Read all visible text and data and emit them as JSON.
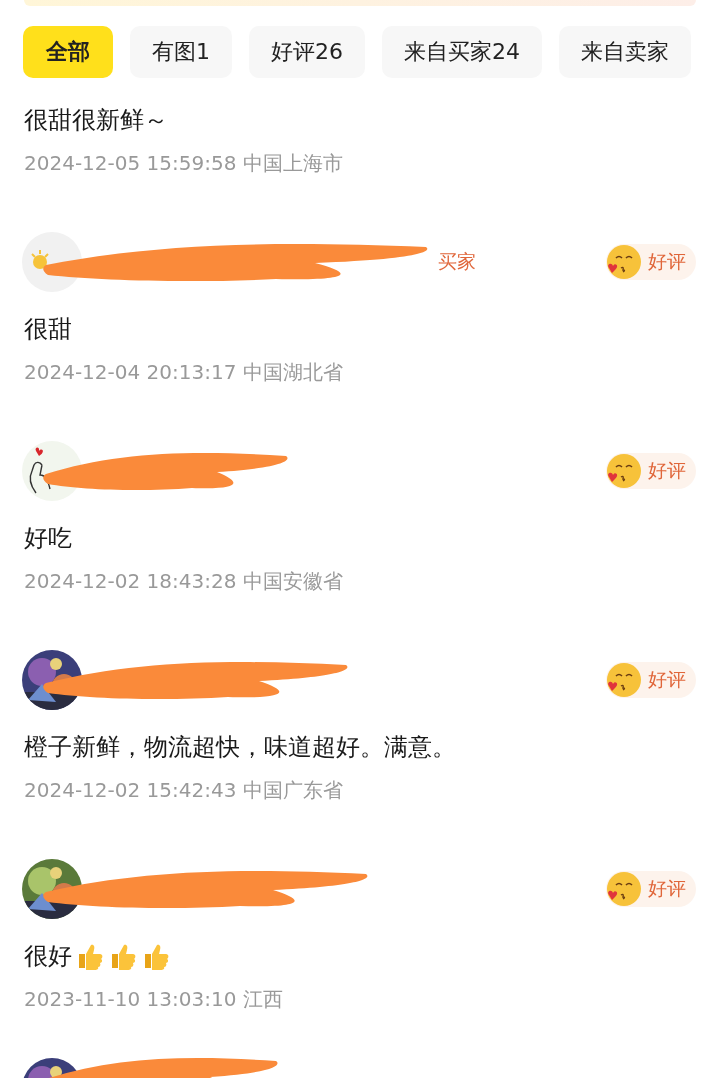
{
  "tabs": [
    {
      "label": "全部",
      "selected": true
    },
    {
      "label": "有图1",
      "selected": false
    },
    {
      "label": "好评26",
      "selected": false
    },
    {
      "label": "来自买家24",
      "selected": false
    },
    {
      "label": "来自卖家",
      "selected": false
    }
  ],
  "reviews": [
    {
      "text": "很甜很新鲜～",
      "meta": "2024-12-05 15:59:58 中国上海市"
    },
    {
      "user": {
        "avatar": {
          "kind": "sun"
        },
        "tag": "买家",
        "rating": "好评"
      },
      "text": "很甜",
      "meta": "2024-12-04 20:13:17 中国湖北省"
    },
    {
      "user": {
        "avatar": {
          "kind": "hand-heart"
        },
        "rating": "好评"
      },
      "text": "好吃",
      "meta": "2024-12-02 18:43:28 中国安徽省"
    },
    {
      "user": {
        "avatar": {
          "kind": "picture"
        },
        "rating": "好评"
      },
      "text": "橙子新鲜，物流超快，味道超好。满意。",
      "meta": "2024-12-02 15:42:43 中国广东省"
    },
    {
      "user": {
        "avatar": {
          "kind": "picture"
        },
        "rating": "好评"
      },
      "text": "很好",
      "emoji": [
        {
          "kind": "thumbs-up"
        },
        {
          "kind": "thumbs-up"
        },
        {
          "kind": "thumbs-up"
        }
      ],
      "meta": "2023-11-10 13:03:10 江西"
    },
    {
      "user": {
        "avatar": {
          "kind": "picture"
        }
      }
    }
  ]
}
